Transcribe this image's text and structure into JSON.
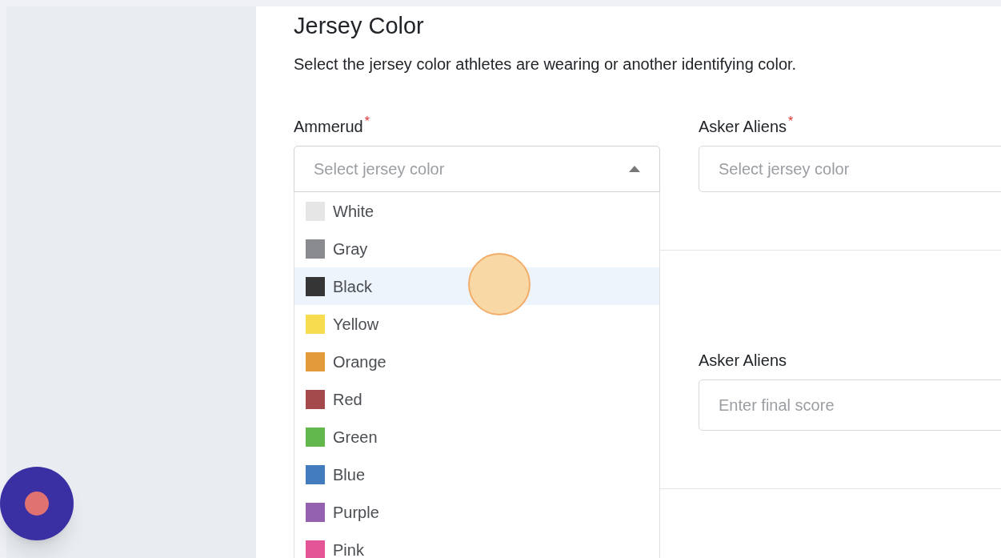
{
  "section": {
    "title": "Jersey Color",
    "description": "Select the jersey color athletes are wearing or another identifying color."
  },
  "jersey_fields": [
    {
      "label": "Ammerud",
      "required_mark": "*",
      "placeholder": "Select jersey color",
      "expanded": true
    },
    {
      "label": "Asker Aliens",
      "required_mark": "*",
      "placeholder": "Select jersey color",
      "expanded": false
    }
  ],
  "color_options": [
    {
      "label": "White",
      "color": "#e6e6e6",
      "selected": false
    },
    {
      "label": "Gray",
      "color": "#8a8b8e",
      "selected": false
    },
    {
      "label": "Black",
      "color": "#353535",
      "selected": true
    },
    {
      "label": "Yellow",
      "color": "#f7dc4f",
      "selected": false
    },
    {
      "label": "Orange",
      "color": "#e39a3a",
      "selected": false
    },
    {
      "label": "Red",
      "color": "#a44a4d",
      "selected": false
    },
    {
      "label": "Green",
      "color": "#62b84d",
      "selected": false
    },
    {
      "label": "Blue",
      "color": "#427cbd",
      "selected": false
    },
    {
      "label": "Purple",
      "color": "#9460b0",
      "selected": false
    },
    {
      "label": "Pink",
      "color": "#e45597",
      "selected": false
    }
  ],
  "score_field": {
    "label": "Asker Aliens",
    "placeholder": "Enter final score"
  }
}
